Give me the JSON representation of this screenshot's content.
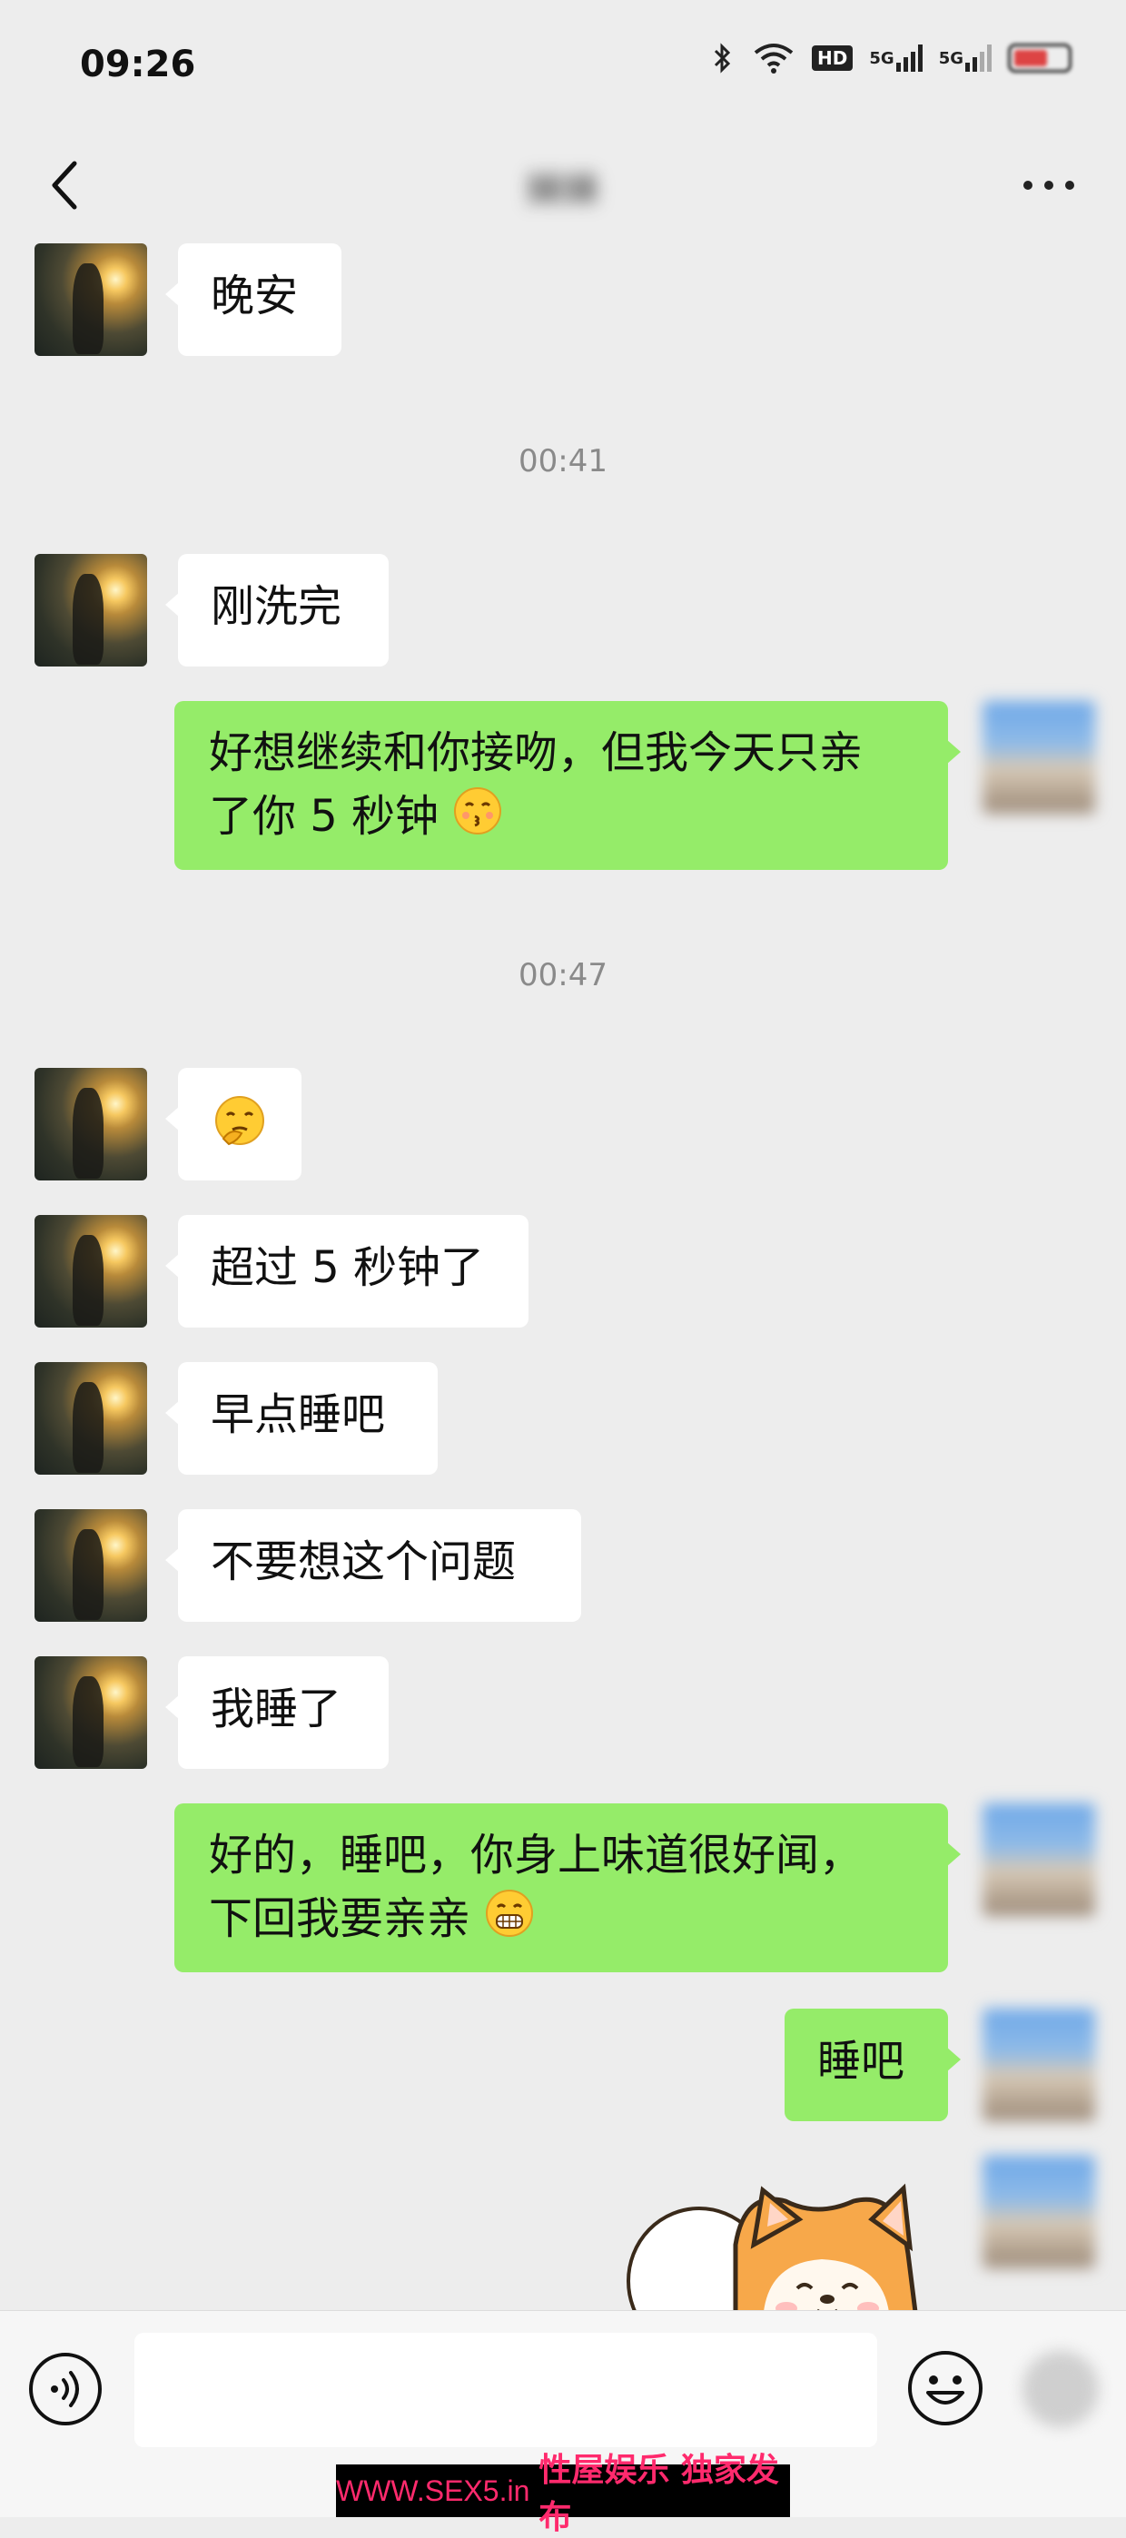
{
  "status_bar": {
    "time": "09:26",
    "hd_label": "HD",
    "network_1": "5G",
    "network_2": "5G"
  },
  "nav": {
    "title": "妹妹"
  },
  "messages": [
    {
      "side": "left",
      "text": "晚安"
    },
    {
      "type": "timestamp",
      "text": "00:41"
    },
    {
      "side": "left",
      "text": "刚洗完"
    },
    {
      "side": "right",
      "text": "好想继续和你接吻，但我今天只亲了你 5 秒钟",
      "emoji": "kissing-face-icon"
    },
    {
      "type": "timestamp",
      "text": "00:47"
    },
    {
      "side": "left",
      "emoji": "thinking-face-icon"
    },
    {
      "side": "left",
      "text": "超过 5 秒钟了"
    },
    {
      "side": "left",
      "text": "早点睡吧"
    },
    {
      "side": "left",
      "text": "不要想这个问题"
    },
    {
      "side": "left",
      "text": "我睡了"
    },
    {
      "side": "right",
      "text": "好的，睡吧，你身上味道很好闻，下回我要亲亲",
      "emoji": "grinning-face-icon"
    },
    {
      "side": "right",
      "text": "睡吧"
    },
    {
      "side": "right",
      "type": "sticker",
      "sticker": "shiba-dog-sticker"
    }
  ],
  "message_lines": {
    "m4_line1": "好想继续和你接吻，但我今天只亲",
    "m4_line2": "了你 5 秒钟",
    "m11_line1": "好的，睡吧，你身上味道很好闻，",
    "m11_line2": "下回我要亲亲"
  },
  "watermark": {
    "url": "WWW.SEX5.in",
    "text": "性屋娱乐 独家发布"
  },
  "colors": {
    "background": "#ededed",
    "bubble_left": "#ffffff",
    "bubble_right": "#95ec69",
    "timestamp": "#8a8a8a",
    "watermark_text": "#ff2a6d"
  }
}
